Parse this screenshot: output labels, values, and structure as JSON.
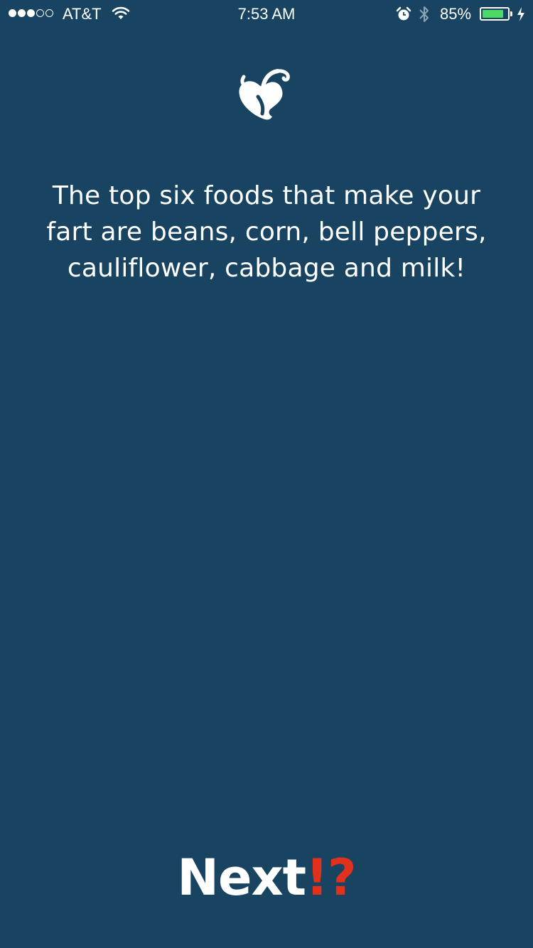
{
  "status_bar": {
    "carrier": "AT&T",
    "time": "7:53 AM",
    "battery_percent": "85%",
    "battery_level": 0.85,
    "signal_filled": 3,
    "signal_total": 5,
    "battery_color": "#4cd964"
  },
  "logo": {
    "icon": "pepper-logo-icon"
  },
  "fact": {
    "text": "The top six foods that make your fart are beans, corn, bell peppers, cauliflower, cabbage and milk!"
  },
  "next_button": {
    "label": "Next",
    "mark": "!?",
    "mark_color": "#e0311c"
  },
  "colors": {
    "background": "#184461",
    "text": "#ffffff"
  }
}
